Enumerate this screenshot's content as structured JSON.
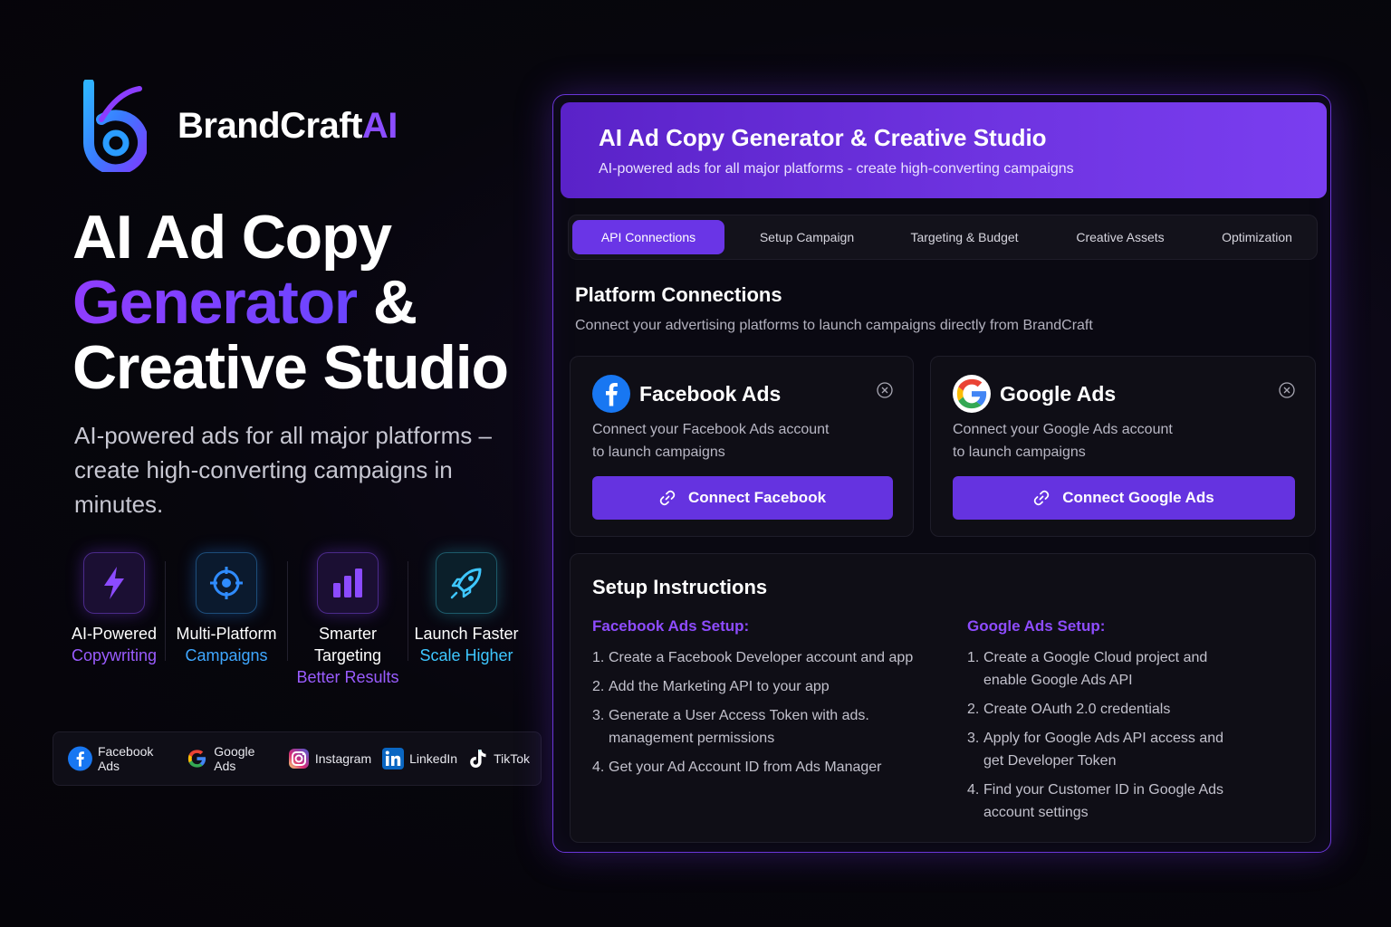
{
  "brand": {
    "name_main": "BrandCraft",
    "name_accent": "AI"
  },
  "hero": {
    "title_line1": "AI Ad Copy",
    "title_line2_accent": "Generator",
    "title_line2_rest": " &",
    "title_line3": "Creative Studio",
    "subtitle": "AI-powered ads for all major platforms – create high-converting campaigns in minutes."
  },
  "features": [
    {
      "title": "AI-Powered",
      "highlight": "Copywriting",
      "icon": "lightning-icon"
    },
    {
      "title": "Multi-Platform",
      "highlight": "Campaigns",
      "icon": "target-icon"
    },
    {
      "title": "Smarter Targeting",
      "highlight": "Better Results",
      "icon": "bar-chart-icon"
    },
    {
      "title": "Launch Faster",
      "highlight": "Scale Higher",
      "icon": "rocket-icon"
    }
  ],
  "platforms": [
    {
      "label": "Facebook Ads",
      "icon": "facebook-icon"
    },
    {
      "label": "Google Ads",
      "icon": "google-icon"
    },
    {
      "label": "Instagram",
      "icon": "instagram-icon"
    },
    {
      "label": "LinkedIn",
      "icon": "linkedin-icon"
    },
    {
      "label": "TikTok",
      "icon": "tiktok-icon"
    }
  ],
  "panel": {
    "title": "AI Ad Copy Generator & Creative Studio",
    "subtitle": "AI-powered ads for all major platforms - create high-converting campaigns"
  },
  "tabs": [
    {
      "label": "API Connections",
      "active": true
    },
    {
      "label": "Setup Campaign",
      "active": false
    },
    {
      "label": "Targeting & Budget",
      "active": false
    },
    {
      "label": "Creative Assets",
      "active": false
    },
    {
      "label": "Optimization",
      "active": false
    }
  ],
  "connections": {
    "title": "Platform Connections",
    "subtitle": "Connect your advertising platforms to launch campaigns directly from BrandCraft",
    "facebook": {
      "name": "Facebook Ads",
      "desc_line1": "Connect your Facebook Ads account",
      "desc_line2": "to launch campaigns",
      "button": "Connect Facebook"
    },
    "google": {
      "name": "Google Ads",
      "desc_line1": "Connect your Google Ads account",
      "desc_line2": "to launch campaigns",
      "button": "Connect Google Ads"
    }
  },
  "instructions": {
    "title": "Setup Instructions",
    "facebook": {
      "heading": "Facebook Ads Setup:",
      "steps": [
        "Create a Facebook Developer account and app",
        "Add the Marketing API to your app",
        "Generate a User Access Token with ads. management permissions",
        "Get your Ad Account ID from Ads Manager"
      ]
    },
    "google": {
      "heading": "Google Ads Setup:",
      "steps": [
        "Create a Google Cloud project and enable Google Ads API",
        "Create OAuth 2.0 credentials",
        "Apply for Google Ads API access and get Developer Token",
        "Find your Customer ID in Google Ads account settings"
      ]
    }
  },
  "colors": {
    "accent": "#6a35e6",
    "accent_text": "#8e4cff",
    "background": "#07060d"
  }
}
